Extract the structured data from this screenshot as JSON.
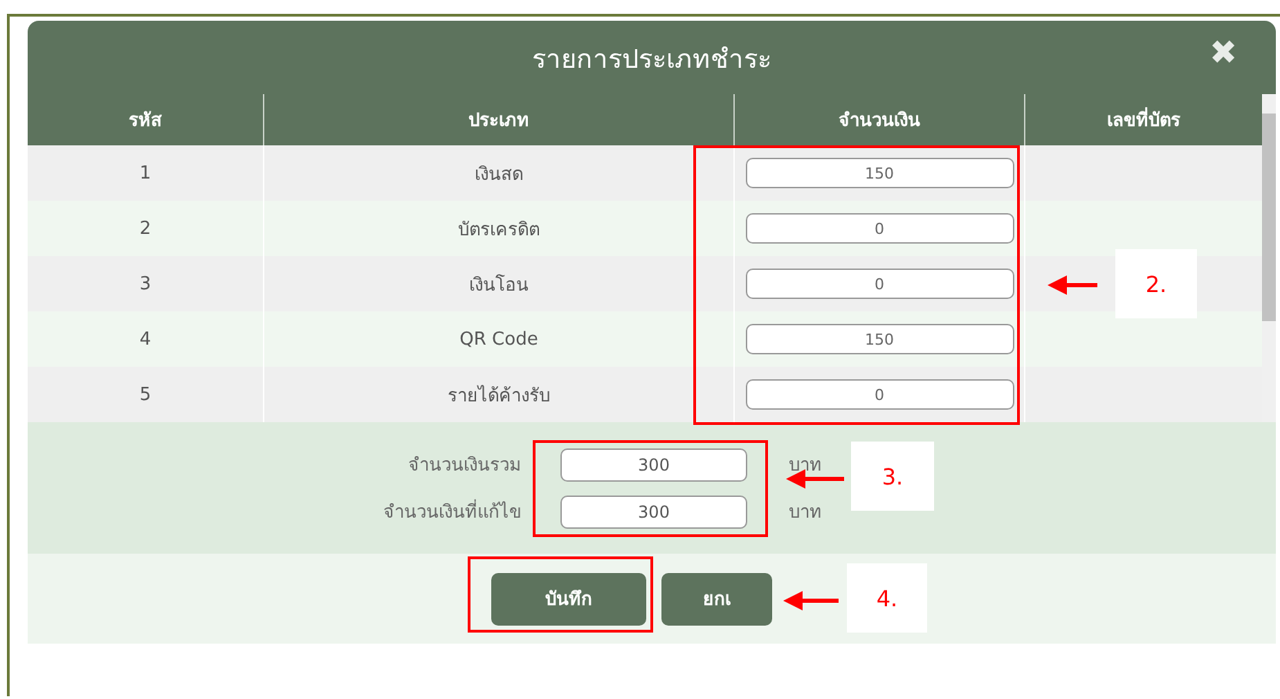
{
  "dialog": {
    "title": "รายการประเภทชำระ",
    "close": "✖"
  },
  "table": {
    "columns": [
      "รหัส",
      "ประเภท",
      "จำนวนเงิน",
      "เลขที่บัตร"
    ],
    "rows": [
      {
        "code": "1",
        "type": "เงินสด",
        "amount": "150"
      },
      {
        "code": "2",
        "type": "บัตรเครดิต",
        "amount": "0"
      },
      {
        "code": "3",
        "type": "เงินโอน",
        "amount": "0"
      },
      {
        "code": "4",
        "type": "QR Code",
        "amount": "150"
      },
      {
        "code": "5",
        "type": "รายได้ค้างรับ",
        "amount": "0"
      }
    ]
  },
  "summary": [
    {
      "label": "จำนวนเงินรวม",
      "value": "300",
      "unit": "บาท"
    },
    {
      "label": "จำนวนเงินที่แก้ไข",
      "value": "300",
      "unit": "บาท"
    }
  ],
  "buttons": [
    "บันทึก",
    "ยกเ"
  ],
  "annotations": [
    "2.",
    "3.",
    "4."
  ]
}
